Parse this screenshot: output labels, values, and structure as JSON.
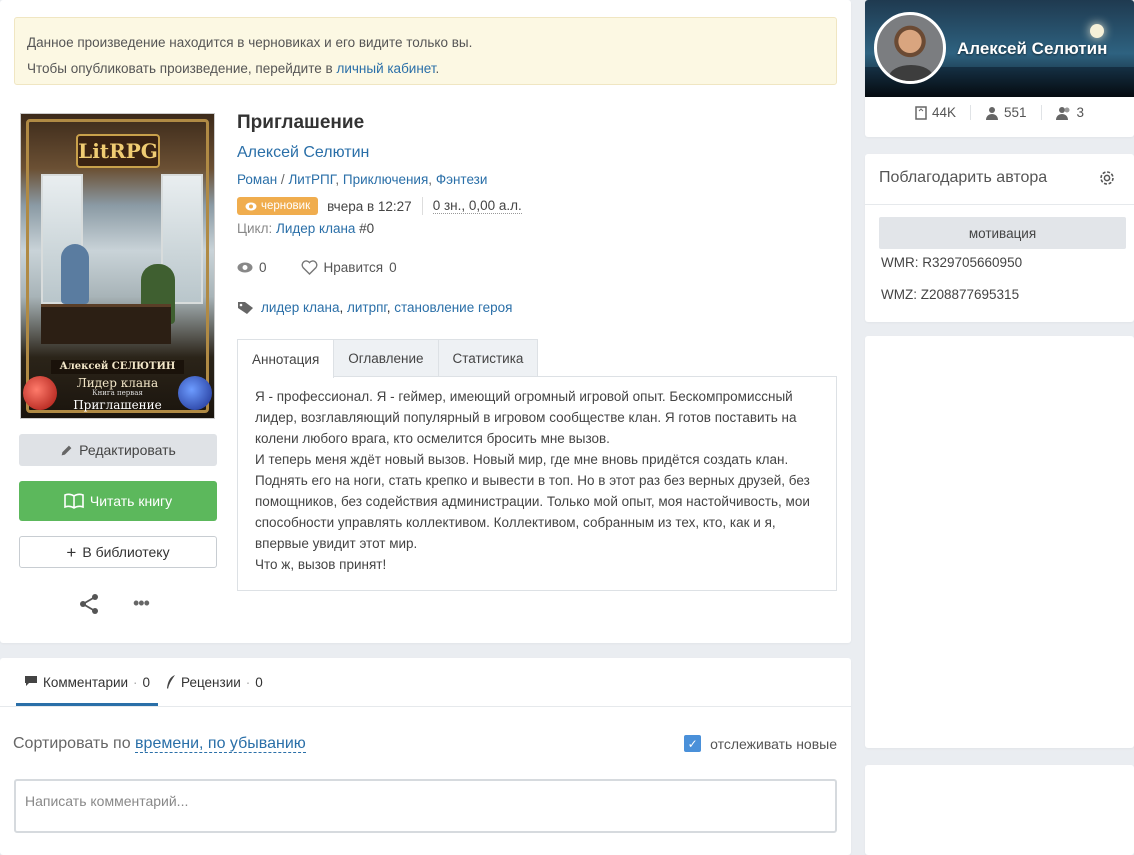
{
  "notice": {
    "line1": "Данное произведение находится в черновиках и его видите только вы.",
    "line2_prefix": "Чтобы опубликовать произведение, перейдите в ",
    "line2_link": "личный кабинет",
    "line2_suffix": "."
  },
  "cover": {
    "logo": "LitRPG",
    "author": "Алексей СЕЛЮТИН",
    "series": "Лидер клана",
    "book": "Книга первая",
    "title": "Приглашение"
  },
  "book": {
    "title": "Приглашение",
    "author": "Алексей Селютин",
    "genre_1": "Роман",
    "genre_sep": " / ",
    "genre_2": "ЛитРПГ",
    "genre_3": "Приключения",
    "genre_4": "Фэнтези",
    "draft_badge": "черновик",
    "date": "вчера в 12:27",
    "size": "0 зн., 0,00 а.л.",
    "cycle_label": "Цикл: ",
    "cycle_name": "Лидер клана",
    "cycle_num": " #0",
    "views": "0",
    "likes_label": "Нравится",
    "likes": "0",
    "tags": [
      "лидер клана",
      "литрпг",
      "становление героя"
    ]
  },
  "buttons": {
    "edit": "Редактировать",
    "read": "Читать книгу",
    "library": "В библиотеку"
  },
  "tabs": [
    "Аннотация",
    "Оглавление",
    "Статистика"
  ],
  "annotation": [
    "Я - профессионал. Я - геймер, имеющий огромный игровой опыт. Бескомпромиссный лидер, возглавляющий популярный в игровом сообществе клан. Я готов поставить на колени любого врага, кто осмелится бросить мне вызов.",
    "И теперь меня ждёт новый вызов. Новый мир, где мне вновь придётся создать клан. Поднять его на ноги, стать крепко и вывести в топ. Но в этот раз без верных друзей, без помощников, без содействия администрации. Только мой опыт, моя настойчивость, мои способности управлять коллективом. Коллективом, собранным из тех, кто, как и я, впервые увидит этот мир.",
    "Что ж, вызов принят!"
  ],
  "comments": {
    "tab_comments": "Комментарии",
    "comments_count": "0",
    "tab_reviews": "Рецензии",
    "reviews_count": "0",
    "sort_label": "Сортировать по ",
    "sort_value": "времени, по убыванию",
    "track_label": "отслеживать новые",
    "track_checked": true,
    "input_placeholder": "Написать комментарий..."
  },
  "author_card": {
    "name": "Алексей Селютин",
    "stat_books": "44K",
    "stat_followers": "551",
    "stat_friends": "3"
  },
  "thanks": {
    "title": "Поблагодарить автора",
    "motivation": "мотивация",
    "wmr": "WMR: R329705660950",
    "wmz": "WMZ: Z208877695315"
  },
  "colors": {
    "link": "#2a6fa8",
    "read_button": "#5cb85c",
    "draft_badge": "#f0ad4e",
    "notice_bg": "#fcf8e3"
  }
}
